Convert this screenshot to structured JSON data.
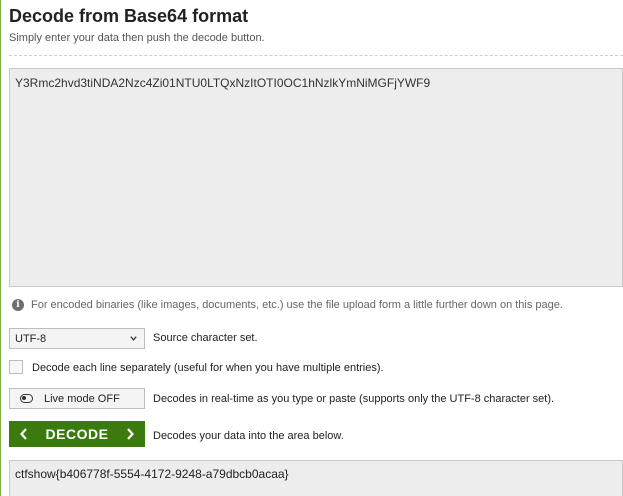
{
  "header": {
    "title": "Decode from Base64 format",
    "subtitle": "Simply enter your data then push the decode button."
  },
  "input": {
    "value": "Y3Rmc2hvd3tiNDA2Nzc4Zi01NTU0LTQxNzItOTI0OC1hNzlkYmNiMGFjYWF9"
  },
  "info": {
    "icon": "info-icon",
    "text": "For encoded binaries (like images, documents, etc.) use the file upload form a little further down on this page."
  },
  "charset": {
    "selected": "UTF-8",
    "label": "Source character set."
  },
  "line_option": {
    "label": "Decode each line separately (useful for when you have multiple entries).",
    "checked": false
  },
  "live_mode": {
    "button_label": "Live mode OFF",
    "description": "Decodes in real-time as you type or paste (supports only the UTF-8 character set)."
  },
  "decode": {
    "button_label": "DECODE",
    "description": "Decodes your data into the area below.",
    "color": "#3b7a0f"
  },
  "output": {
    "value": "ctfshow{b406778f-5554-4172-9248-a79dbcb0acaa}"
  }
}
